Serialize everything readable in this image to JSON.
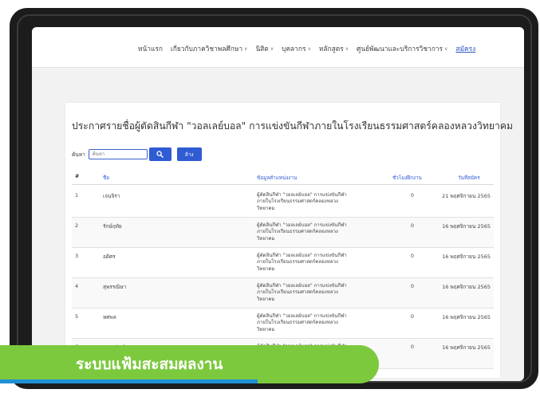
{
  "nav": {
    "items": [
      {
        "label": "หน้าแรก",
        "dropdown": false,
        "active": false
      },
      {
        "label": "เกี่ยวกับภาควิชาพลศึกษา",
        "dropdown": true,
        "active": false
      },
      {
        "label": "นิสิต",
        "dropdown": true,
        "active": false
      },
      {
        "label": "บุคลากร",
        "dropdown": true,
        "active": false
      },
      {
        "label": "หลักสูตร",
        "dropdown": true,
        "active": false
      },
      {
        "label": "ศูนย์พัฒนาและบริการวิชาการ",
        "dropdown": true,
        "active": false
      },
      {
        "label": "สมัครง",
        "dropdown": false,
        "active": true
      }
    ]
  },
  "page": {
    "title": "ประกาศรายชื่อผู้ตัดสินกีฬา \"วอลเลย์บอล\" การแข่งขันกีฬาภายในโรงเรียนธรรมศาสตร์คลองหลวงวิทยาคม"
  },
  "search": {
    "label": "ค้นหา",
    "placeholder": "ค้นหา",
    "value": "",
    "clear_label": "ล้าง"
  },
  "table": {
    "columns": [
      "#",
      "ชื่อ",
      "ข้อมูลตำแหน่งงาน",
      "ชั่วโมงฝึกงาน",
      "วันที่สมัคร"
    ],
    "rows": [
      {
        "no": "1",
        "name": "เจนจิรา",
        "role": "ผู้ตัดสินกีฬา \"วอลเลย์บอล\" การแข่งขันกีฬาภายในโรงเรียนธรรมศาสตร์คลองหลวงวิทยาคม",
        "hours": "0",
        "date": "21 พฤศจิกายน 2565"
      },
      {
        "no": "2",
        "name": "รักษ์ฤทัย",
        "role": "ผู้ตัดสินกีฬา \"วอลเลย์บอล\" การแข่งขันกีฬาภายในโรงเรียนธรรมศาสตร์คลองหลวงวิทยาคม",
        "hours": "0",
        "date": "16 พฤศจิกายน 2565"
      },
      {
        "no": "3",
        "name": "อดิศร",
        "role": "ผู้ตัดสินกีฬา \"วอลเลย์บอล\" การแข่งขันกีฬาภายในโรงเรียนธรรมศาสตร์คลองหลวงวิทยาคม",
        "hours": "0",
        "date": "16 พฤศจิกายน 2565"
      },
      {
        "no": "4",
        "name": "สุพรรณิษา",
        "role": "ผู้ตัดสินกีฬา \"วอลเลย์บอล\" การแข่งขันกีฬาภายในโรงเรียนธรรมศาสตร์คลองหลวงวิทยาคม",
        "hours": "0",
        "date": "16 พฤศจิกายน 2565"
      },
      {
        "no": "5",
        "name": "ทศพล",
        "role": "ผู้ตัดสินกีฬา \"วอลเลย์บอล\" การแข่งขันกีฬาภายในโรงเรียนธรรมศาสตร์คลองหลวงวิทยาคม",
        "hours": "0",
        "date": "16 พฤศจิกายน 2565"
      },
      {
        "no": "6",
        "name": "เบญจรัตน์",
        "role": "ผู้ตัดสินกีฬา \"วอลเลย์บอล\" การแข่งขันกีฬาภายในโรงเรียนธรรมศาสตร์",
        "hours": "0",
        "date": "16 พฤศจิกายน 2565"
      }
    ]
  },
  "banner": {
    "text": "ระบบแฟ้มสะสมผลงาน"
  },
  "colors": {
    "accent": "#2f5bd3",
    "banner_green": "#7cc93e",
    "banner_blue": "#1f8fd6",
    "device_frame": "#1c1c1c"
  },
  "icons": {
    "search_button": "search-icon",
    "nav_dropdown": "chevron-down-icon"
  }
}
